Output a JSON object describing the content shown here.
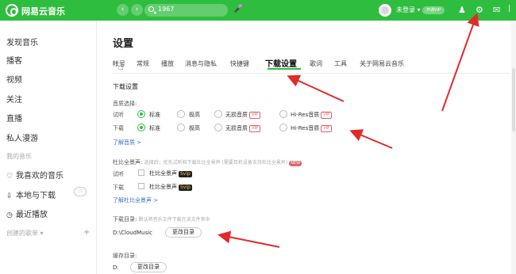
{
  "topbar": {
    "app_name": "网易云音乐",
    "back_icon": "chevron-left-icon",
    "forward_icon": "chevron-right-icon",
    "search_value": "1967",
    "login_text": "未登录 ▾",
    "vip_badge": "开通VIP",
    "icons": [
      "shirt-icon",
      "gear-icon",
      "mail-icon"
    ],
    "accent": "#2fbd3f"
  },
  "sidebar": {
    "discover": "发现音乐",
    "podcast": "播客",
    "video": "视频",
    "follow": "关注",
    "live": "直播",
    "fm": "私人漫游",
    "my_music_header": "我的音乐",
    "liked": "我喜欢的音乐",
    "local": "本地与下载",
    "recent": "最近播放",
    "created": "创建的歌单 ▾",
    "add_symbol": "+"
  },
  "main": {
    "title": "设置",
    "tabs": [
      "帐号",
      "常规",
      "播放",
      "消息与隐私",
      "快捷键",
      "下载设置",
      "歌词",
      "工具",
      "关于网易云音乐"
    ],
    "active_tab": "下载设置",
    "download_section": "下载设置",
    "quality_label": "音质选择:",
    "trial_row_label": "试听",
    "download_row_label": "下载",
    "quality_options": [
      "标准",
      "极高",
      "无损音质",
      "Hi-Res音质"
    ],
    "vip_tag": "VIP",
    "learn_quality": "了解音质 >",
    "dolby_label": "杜比全景声:",
    "dolby_hint": "选择后，优先试听和下载杜比全景声 (需要耳机设备支持杜比全景声)",
    "new_tag": "NEW",
    "dolby_option": "杜比全景声",
    "dolby_svip": "Svip",
    "learn_dolby": "了解杜比全景声 >",
    "dir_label": "下载目录:",
    "dir_hint": "默认将音乐文件下载在该文件夹中",
    "dir_path": "D:\\CloudMusic",
    "change_dir": "更改目录",
    "cache_label": "缓存目录:",
    "cache_path": "D:",
    "change_cache": "更改目录"
  }
}
